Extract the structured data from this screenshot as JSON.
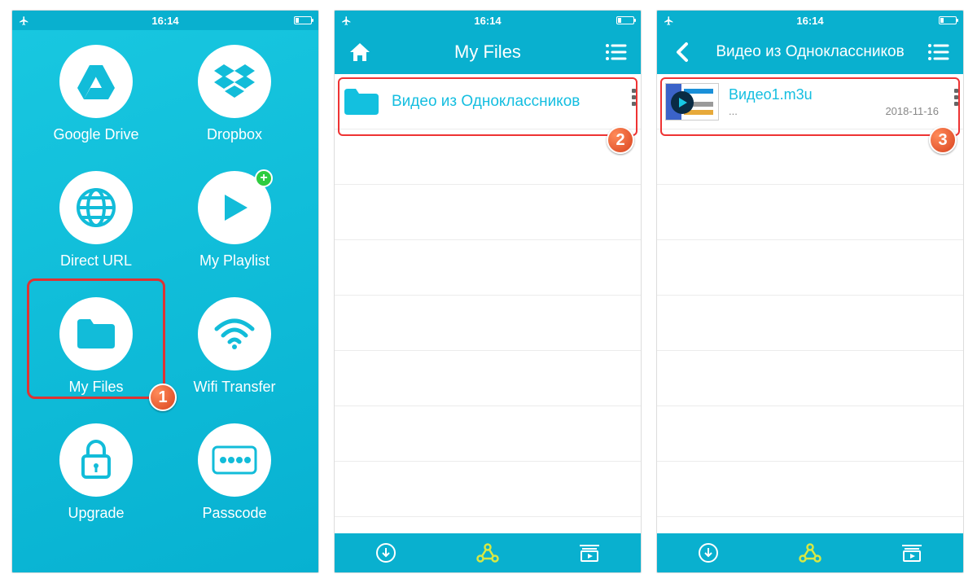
{
  "status": {
    "time": "16:14"
  },
  "screen1": {
    "items": [
      {
        "label": "Google Drive"
      },
      {
        "label": "Dropbox"
      },
      {
        "label": "Direct URL"
      },
      {
        "label": "My Playlist"
      },
      {
        "label": "My Files"
      },
      {
        "label": "Wifi Transfer"
      },
      {
        "label": "Upgrade"
      },
      {
        "label": "Passcode"
      }
    ],
    "badge": "1"
  },
  "screen2": {
    "title": "My Files",
    "folder": "Видео из Одноклассников",
    "badge": "2"
  },
  "screen3": {
    "title": "Видео из Одноклассников",
    "file": {
      "name": "Видео1.m3u",
      "sub": "...",
      "date": "2018-11-16"
    },
    "badge": "3"
  }
}
